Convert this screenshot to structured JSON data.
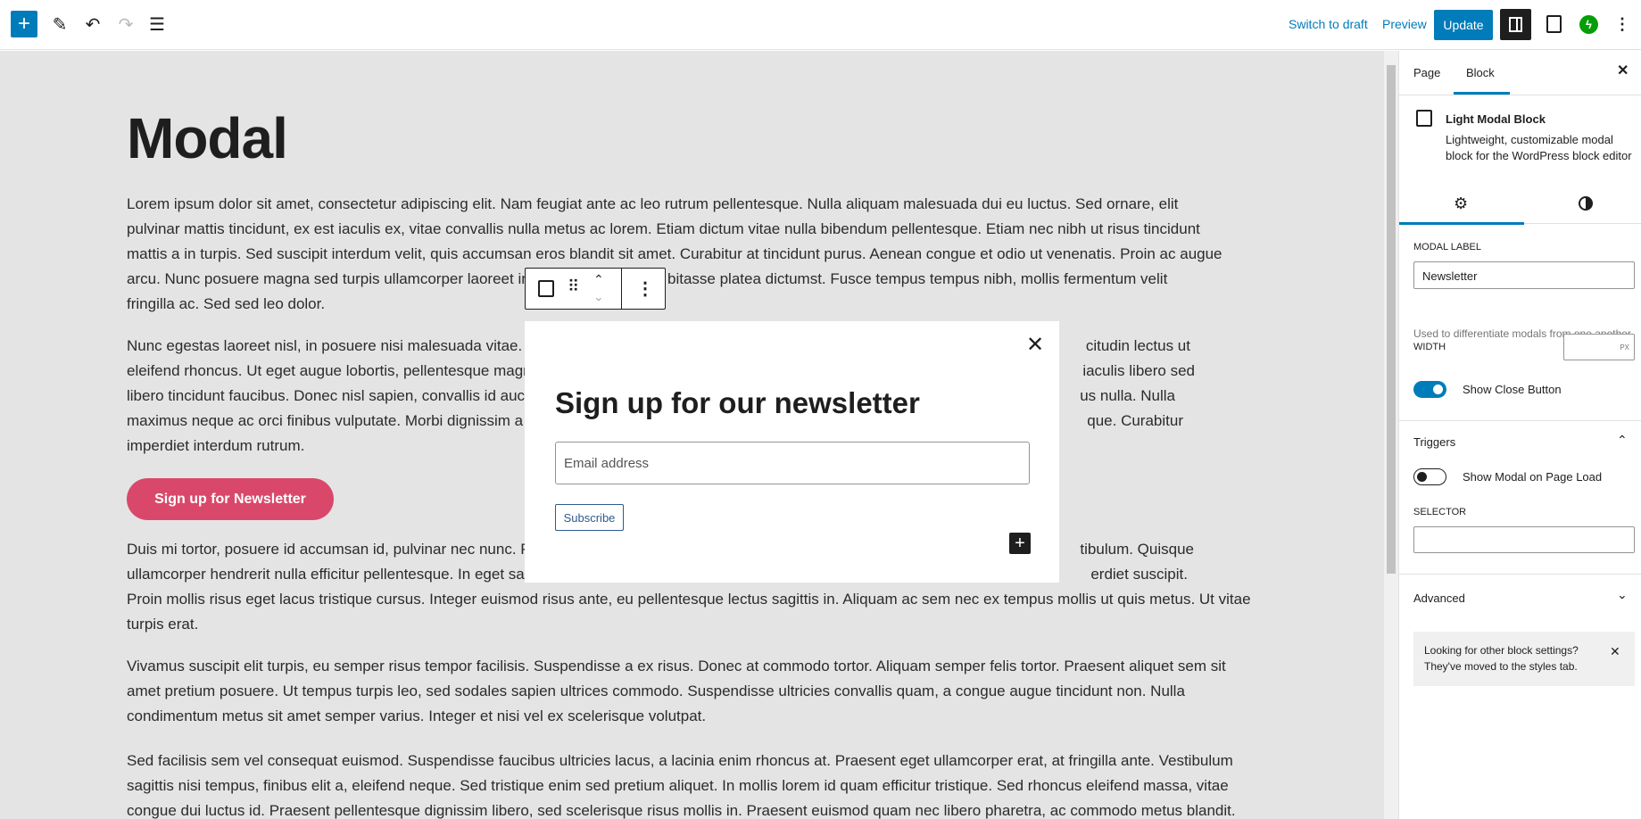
{
  "topbar": {
    "add_icon": "plus-icon",
    "tools_icon": "pencil-icon",
    "undo_icon": "undo-icon",
    "redo_icon": "redo-icon",
    "list_view_icon": "list-view-icon",
    "switch_to_draft": "Switch to draft",
    "preview": "Preview",
    "update": "Update",
    "settings_icon": "sidebar-toggle-icon",
    "modal_plugin_icon": "modal-block-icon",
    "jetpack_icon": "jetpack-bolt-icon",
    "options_icon": "more-vertical-icon",
    "accent": "#007cba"
  },
  "content": {
    "title": "Modal",
    "p1": [
      {
        "l": "Lorem ipsum dolor sit amet, consectetur adipiscing elit. Nam feugiat ante ac leo rutrum pellentesque. Nulla aliquam malesuada dui eu luctus. Sed ornare, elit"
      },
      {
        "l": "pulvinar mattis tincidunt, ex est iaculis ex, vitae convallis nulla metus ac lorem. Etiam dictum vitae nulla bibendum pellentesque. Etiam nec nibh ut risus tincidunt"
      },
      {
        "l": "mattis a in turpis. Sed suscipit interdum velit, quis accumsan eros blandit sit amet. Curabitur at tincidunt purus. Aenean congue et odio ut venenatis. Proin ac augue"
      },
      {
        "l": "arcu. Nunc posuere magna sed turpis ullamcorper laoreet in s",
        "r": "bitasse platea dictumst. Fusce tempus tempus nibh, mollis fermentum velit"
      },
      {
        "l": "fringilla ac. Sed sed leo dolor."
      }
    ],
    "p2": [
      {
        "l": "Nunc egestas laoreet nisl, in posuere nisi malesuada vitae. Pro",
        "r": "citudin lectus ut"
      },
      {
        "l": "eleifend rhoncus. Ut eget augue lobortis, pellentesque magna",
        "r": "iaculis libero sed"
      },
      {
        "l": "libero tincidunt faucibus. Donec nisl sapien, convallis id auctor",
        "r": "us nulla. Nulla"
      },
      {
        "l": "maximus neque ac orci finibus vulputate. Morbi dignissim a er",
        "r": "que. Curabitur"
      },
      {
        "l": "imperdiet interdum rutrum."
      }
    ],
    "cta_button": "Sign up for Newsletter",
    "cta_color": "#d9486a",
    "p3": [
      {
        "l": "Duis mi tortor, posuere id accumsan id, pulvinar nec nunc. Pell",
        "r": "tibulum. Quisque"
      },
      {
        "l": "ullamcorper hendrerit nulla efficitur pellentesque. In eget sag",
        "r": "erdiet suscipit."
      },
      {
        "l": "Proin mollis risus eget lacus tristique cursus. Integer euismod risus ante, eu pellentesque lectus sagittis in. Aliquam ac sem nec ex tempus mollis ut quis metus. Ut vitae"
      },
      {
        "l": "turpis erat."
      }
    ],
    "p4": [
      {
        "l": "Vivamus suscipit elit turpis, eu semper risus tempor facilisis. Suspendisse a ex risus. Donec at commodo tortor. Aliquam semper felis tortor. Praesent aliquet sem sit"
      },
      {
        "l": "amet pretium posuere. Ut tempus turpis leo, sed sodales sapien ultrices commodo. Suspendisse ultricies convallis quam, a congue augue tincidunt non. Nulla"
      },
      {
        "l": "condimentum metus sit amet semper varius. Integer et nisi vel ex scelerisque volutpat."
      }
    ],
    "p5": [
      {
        "l": "Sed facilisis sem vel consequat euismod. Suspendisse faucibus ultricies lacus, a lacinia enim rhoncus at. Praesent eget ullamcorper erat, at fringilla ante. Vestibulum"
      },
      {
        "l": "sagittis nisi tempus, finibus elit a, eleifend neque. Sed tristique enim sed pretium aliquet. In mollis lorem id quam efficitur tristique. Sed rhoncus eleifend massa, vitae"
      },
      {
        "l": "congue dui luctus id. Praesent pellentesque dignissim libero, sed scelerisque risus mollis in. Praesent euismod quam nec libero pharetra, ac commodo metus blandit."
      }
    ]
  },
  "modal": {
    "heading": "Sign up for our newsletter",
    "email_placeholder": "Email address",
    "subscribe": "Subscribe",
    "close_icon": "close-icon",
    "add_block_icon": "plus-icon"
  },
  "block_toolbar": {
    "block_icon": "modal-block-icon",
    "drag_icon": "drag-handle-icon",
    "move_up_icon": "chevron-up-icon",
    "move_down_icon": "chevron-down-icon",
    "options_icon": "more-vertical-icon"
  },
  "sidebar": {
    "tabs": [
      {
        "label": "Page"
      },
      {
        "label": "Block",
        "active": true
      }
    ],
    "block_title": "Light Modal Block",
    "block_desc_1": "Lightweight, customizable modal",
    "block_desc_2": "block for the WordPress block editor",
    "modal_label_label": "MODAL LABEL",
    "modal_label_value": "Newsletter",
    "modal_label_help": "Used to differentiate modals from one another",
    "width_label": "WIDTH",
    "width_unit": "PX",
    "show_close_label": "Show Close Button",
    "show_close_on": true,
    "triggers_title": "Triggers",
    "page_load_label": "Show Modal on Page Load",
    "page_load_on": false,
    "selector_label": "SELECTOR",
    "selector_value": "",
    "advanced_title": "Advanced",
    "notice_1": "Looking for other block settings?",
    "notice_2": "They've moved to the styles tab."
  }
}
